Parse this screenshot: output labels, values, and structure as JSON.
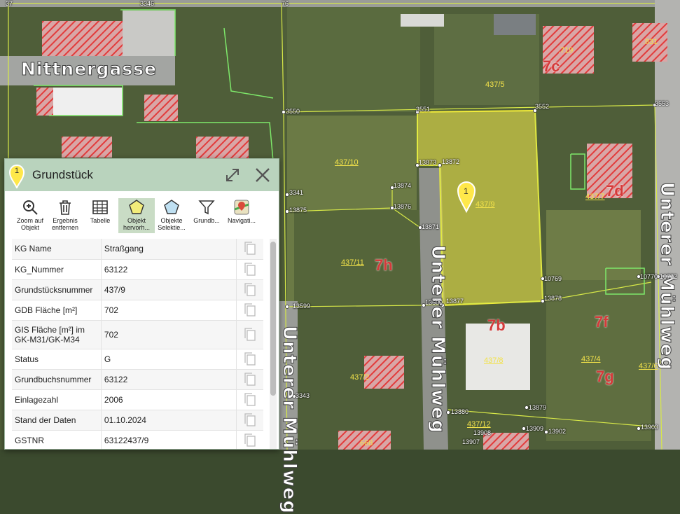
{
  "panel": {
    "title": "Grundstück",
    "marker_number": "1",
    "tools": [
      {
        "label": "Zoom auf\nObjekt",
        "icon": "zoom-icon"
      },
      {
        "label": "Ergebnis\nentfernen",
        "icon": "trash-icon"
      },
      {
        "label": "Tabelle",
        "icon": "table-icon"
      },
      {
        "label": "Objekt\nhervorh...",
        "icon": "pentagon-highlight-icon"
      },
      {
        "label": "Objekte\nSelektie...",
        "icon": "pentagon-select-icon"
      },
      {
        "label": "Grundb...",
        "icon": "filter-icon"
      },
      {
        "label": "Navigati...",
        "icon": "navigation-icon"
      }
    ],
    "rows": [
      {
        "key": "KG Name",
        "value": "Straßgang"
      },
      {
        "key": "KG_Nummer",
        "value": "63122"
      },
      {
        "key": "Grundstücksnummer",
        "value": "437/9"
      },
      {
        "key": "GDB Fläche [m²]",
        "value": "702"
      },
      {
        "key": "GIS Fläche [m²] im GK-M31/GK-M34",
        "value": "702"
      },
      {
        "key": "Status",
        "value": "G"
      },
      {
        "key": "Grundbuchsnummer",
        "value": "63122"
      },
      {
        "key": "Einlagezahl",
        "value": "2006"
      },
      {
        "key": "Stand der Daten",
        "value": "01.10.2024"
      },
      {
        "key": "GSTNR",
        "value": "63122437/9"
      }
    ]
  },
  "map": {
    "streets": {
      "nittnergasse": "Nittnergasse",
      "unterer_muehlweg": "Unterer Mühlweg"
    },
    "selected_marker": "1",
    "parcels": {
      "p437_9": "437/9",
      "p437_10": "437/10",
      "p437_11": "437/11",
      "p437_5": "437/5",
      "p437_7": "437/7",
      "p437_2": "437/2",
      "p437_8": "437/8",
      "p437_4": "437/4",
      "p437_6": "437/6",
      "p437_12": "437/12",
      "p719": ".719",
      "p831": ".831",
      "p668": ".668"
    },
    "buildings": {
      "b7h": "7h",
      "b7b": "7b",
      "b7f": "7f",
      "b7g": "7g",
      "b7d": "7d",
      "b7c": "7c"
    },
    "points": {
      "p3550": "3550",
      "p3551": "3551",
      "p3552": "3552",
      "p3553": "3553",
      "p13873": "13873",
      "p13872": "13872",
      "p13874": "13874",
      "p13876": "13876",
      "p13871": "13871",
      "p13875": "13875",
      "p3341": "3341",
      "p13599": "13599",
      "p13600": "13600",
      "p13877": "13877",
      "p13878": "13878",
      "p10769": "10769",
      "p10770": "10770",
      "p10772": "10772",
      "p13879": "13879",
      "p13880": "13880",
      "p13909": "13909",
      "p13902": "13902",
      "p13903": "13903",
      "p13907": "13907",
      "p13908": "13908",
      "p3343": "3343",
      "p3346": "3346",
      "p76": "76",
      "p37": "37"
    },
    "colors": {
      "selection": "#e5e04a",
      "boundary": "#7ee86a",
      "building_hatch": "#e23b3b"
    }
  }
}
